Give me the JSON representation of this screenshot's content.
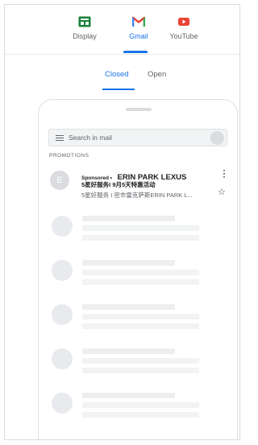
{
  "format_tabs": [
    {
      "label": "Display",
      "icon": "display-icon",
      "color": "#188038"
    },
    {
      "label": "Gmail",
      "icon": "gmail-icon",
      "color": "#ea4335",
      "active": true
    },
    {
      "label": "YouTube",
      "icon": "youtube-icon",
      "color": "#ea4335"
    }
  ],
  "state_tabs": [
    {
      "label": "Closed",
      "active": true
    },
    {
      "label": "Open"
    }
  ],
  "accent_color": "#1a73e8",
  "inbox": {
    "search_placeholder": "Search in mail",
    "section_label": "PROMOTIONS",
    "ad": {
      "avatar_letter": "E",
      "sponsored_label": "Sponsored •",
      "sender": "ERIN PARK LEXUS",
      "subject": "5星好服务I 9月5天特惠活动",
      "preview": "5星好服务 I 密市雷克萨斯ERIN PARK L..."
    },
    "placeholder_row_count": 5
  }
}
